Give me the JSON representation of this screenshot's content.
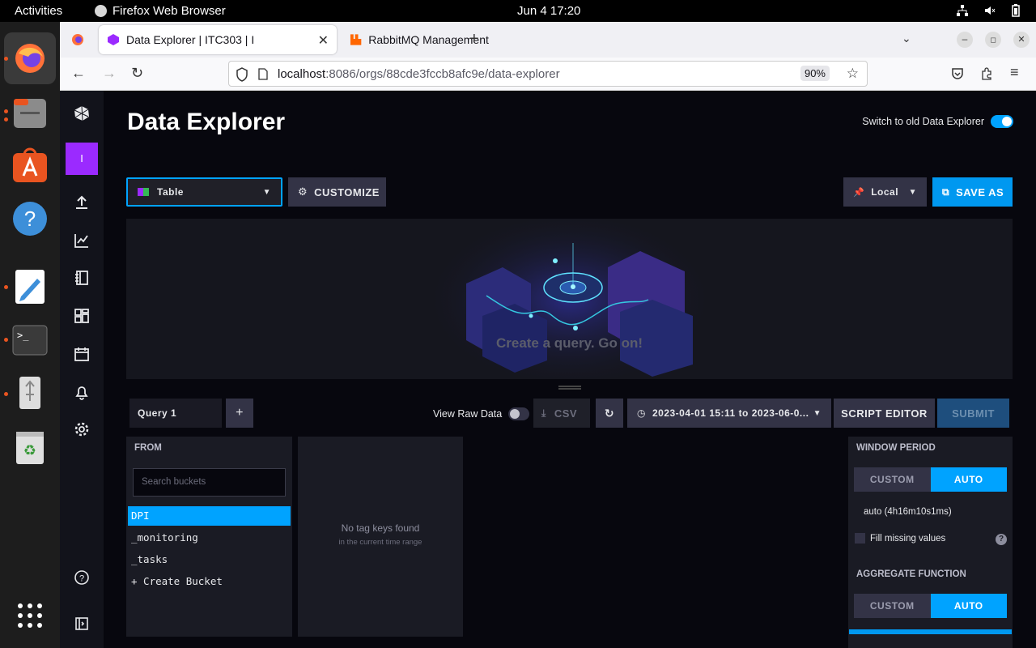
{
  "system": {
    "activities": "Activities",
    "app_name": "Firefox Web Browser",
    "clock": "Jun 4  17:20"
  },
  "browser": {
    "tabs": [
      {
        "title": "Data Explorer | ITC303 | I"
      },
      {
        "title": "RabbitMQ Management"
      }
    ],
    "url_host": "localhost",
    "url_path": ":8086/orgs/88cde3fccb8afc9e/data-explorer",
    "zoom": "90%"
  },
  "sidebar": {
    "org_initial": "I"
  },
  "page": {
    "title": "Data Explorer",
    "old_explorer_label": "Switch to old Data Explorer",
    "visualization": "Table",
    "customize_label": "CUSTOMIZE",
    "timezone": "Local",
    "save_as_label": "SAVE AS",
    "empty_message": "Create a query. Go on!"
  },
  "query": {
    "tab_name": "Query 1",
    "add_label": "+",
    "raw_data_label": "View Raw Data",
    "csv_label": "CSV",
    "time_range": "2023-04-01 15:11 to 2023-06-0...",
    "script_editor_label": "SCRIPT EDITOR",
    "submit_label": "SUBMIT"
  },
  "from_panel": {
    "header": "FROM",
    "search_placeholder": "Search buckets",
    "buckets": [
      "DPI",
      "_monitoring",
      "_tasks",
      "+ Create Bucket"
    ]
  },
  "tag_panel": {
    "message": "No tag keys found",
    "submessage": "in the current time range"
  },
  "window_panel": {
    "header": "WINDOW PERIOD",
    "custom_label": "CUSTOM",
    "auto_label": "AUTO",
    "auto_value": "auto (4h16m10s1ms)",
    "fill_label": "Fill missing values",
    "aggregate_header": "AGGREGATE FUNCTION",
    "agg_custom_label": "CUSTOM",
    "agg_auto_label": "AUTO"
  },
  "colors": {
    "accent": "#00a3ff",
    "org": "#9b2aff",
    "background": "#07070e"
  }
}
